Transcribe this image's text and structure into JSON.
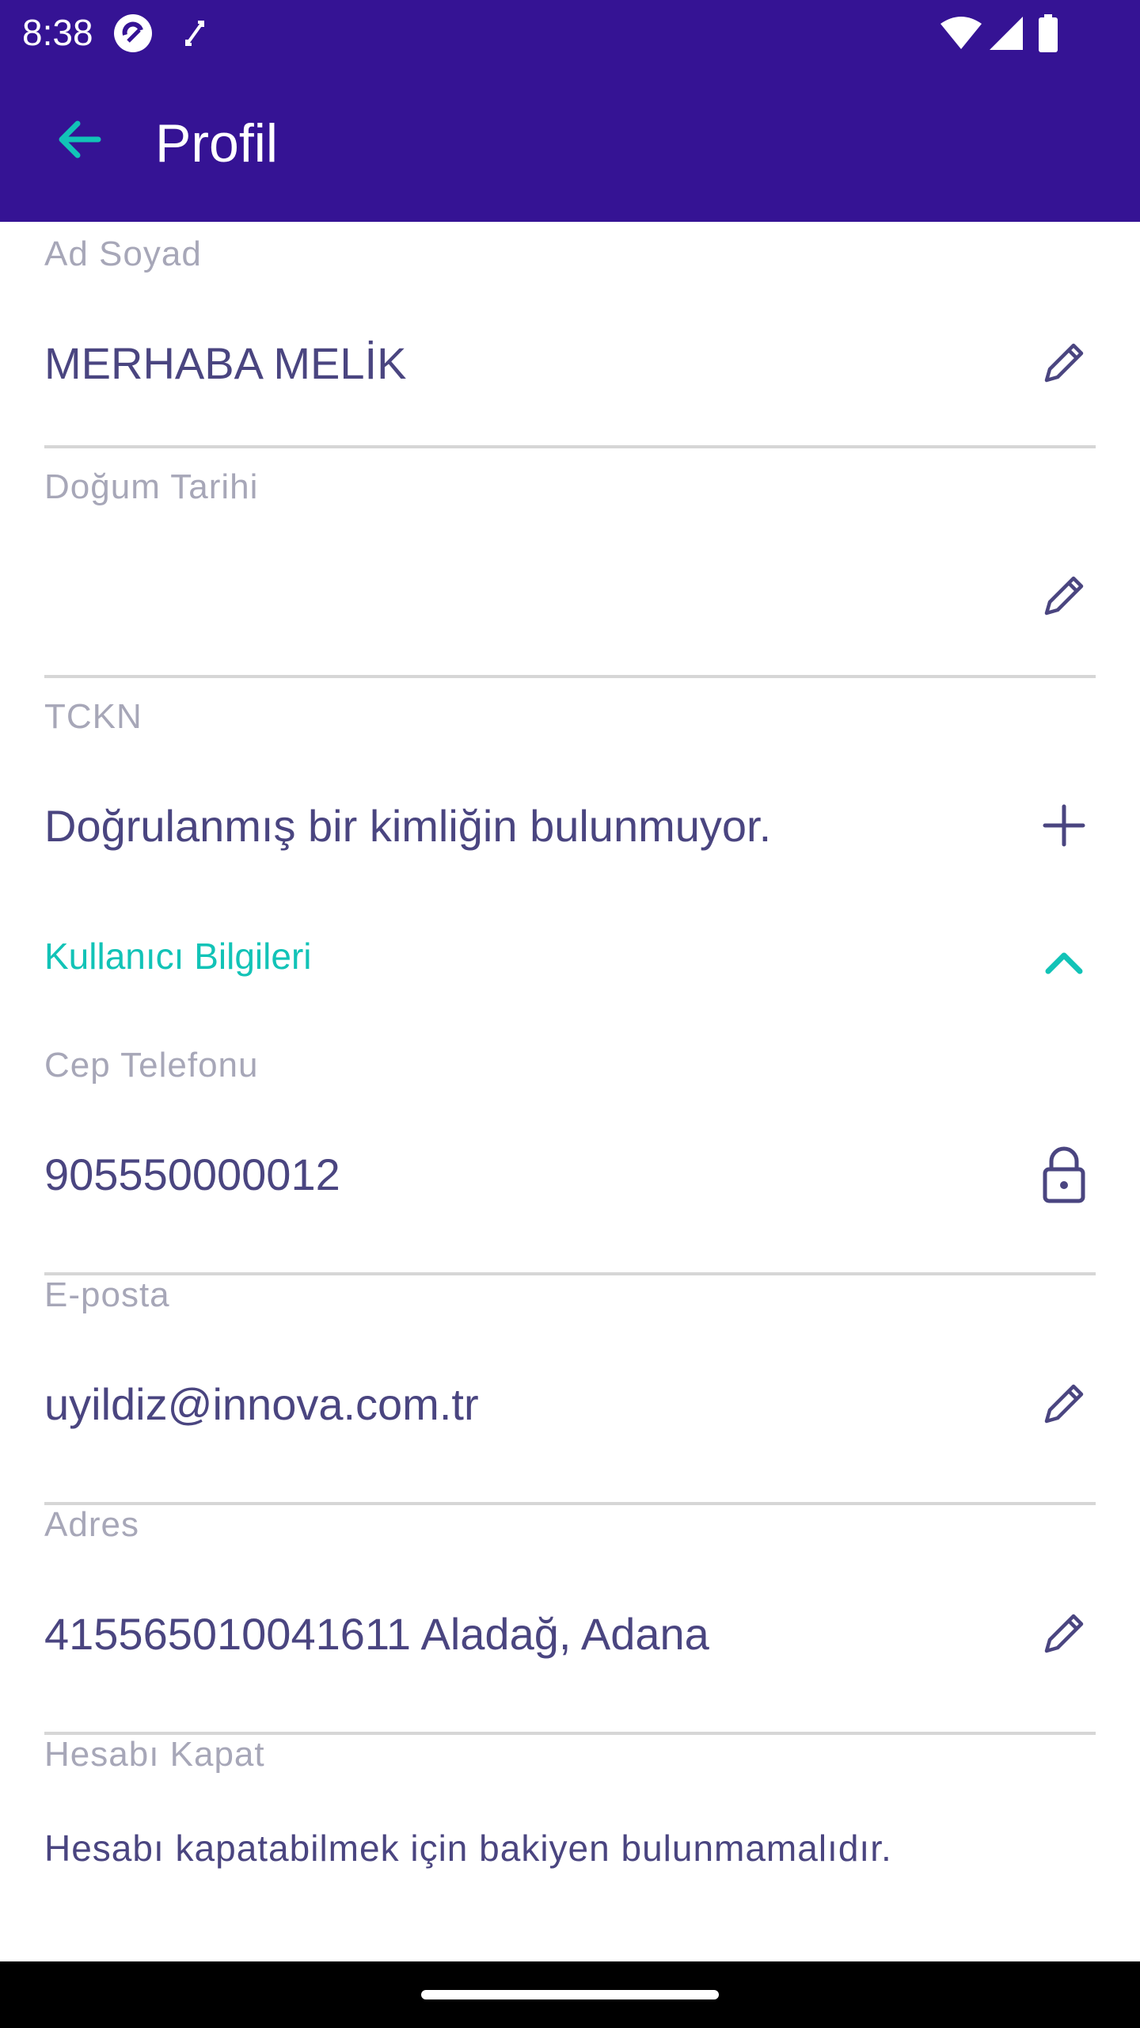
{
  "status_bar": {
    "time": "8:38",
    "icons": [
      "app-notification-icon",
      "screen-rotate-icon",
      "wifi-icon",
      "signal-icon",
      "battery-icon"
    ]
  },
  "app_bar": {
    "title": "Profil",
    "back_icon": "arrow-back-icon"
  },
  "colors": {
    "primary": "#351394",
    "accent": "#12c3b7",
    "text": "#4a4580",
    "label": "#a7a7b8"
  },
  "fields": {
    "name": {
      "label": "Ad Soyad",
      "value": "MERHABA MELİK",
      "action_icon": "edit-pencil-icon"
    },
    "birth_date": {
      "label": "Doğum Tarihi",
      "value": "",
      "action_icon": "edit-pencil-icon"
    },
    "tckn": {
      "label": "TCKN",
      "value": "Doğrulanmış bir kimliğin bulunmuyor.",
      "action_icon": "add-plus-icon"
    }
  },
  "user_info_section": {
    "title": "Kullanıcı Bilgileri",
    "expanded": true,
    "phone": {
      "label": "Cep Telefonu",
      "value": "905550000012",
      "action_icon": "lock-icon"
    },
    "email": {
      "label": "E-posta",
      "value": "uyildiz@innova.com.tr",
      "action_icon": "edit-pencil-icon"
    },
    "address": {
      "label": "Adres",
      "value": "415565010041611 Aladağ, Adana",
      "action_icon": "edit-pencil-icon"
    }
  },
  "close_account": {
    "label": "Hesabı Kapat",
    "message": "Hesabı kapatabilmek için bakiyen bulunmamalıdır."
  }
}
